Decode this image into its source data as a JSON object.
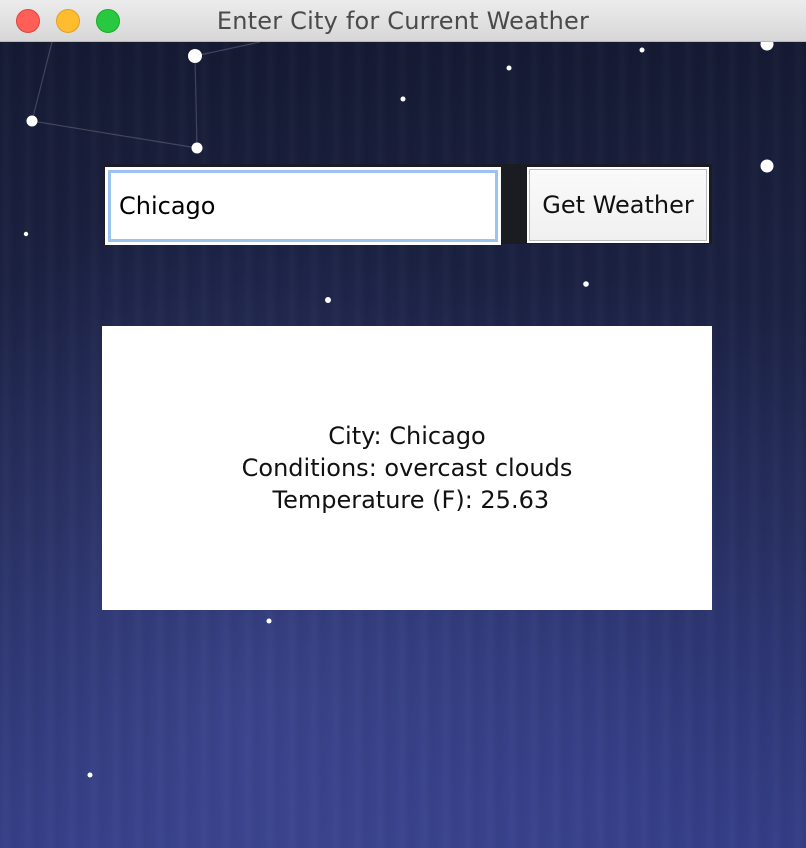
{
  "window": {
    "title": "Enter City for Current Weather"
  },
  "search": {
    "city_value": "Chicago",
    "button_label": "Get Weather"
  },
  "result": {
    "line_city": "City: Chicago",
    "line_conditions": "Conditions: overcast clouds",
    "line_temperature": " Temperature (F): 25.63"
  },
  "colors": {
    "close": "#fe5f57",
    "minimize": "#febc2e",
    "zoom": "#28c840",
    "input_focus_ring": "#9cc3ee"
  }
}
